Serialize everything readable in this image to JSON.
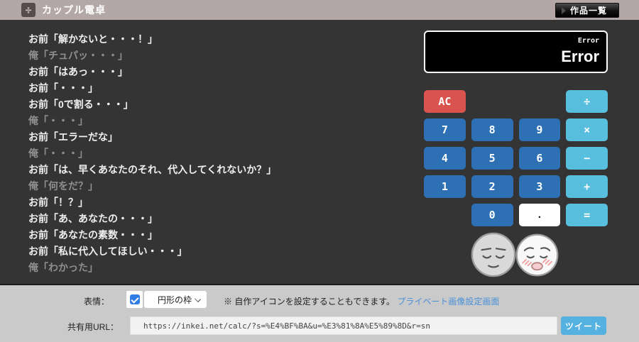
{
  "header": {
    "title": "カップル電卓",
    "icon_glyph": "÷",
    "works_button": "作品一覧"
  },
  "dialogue": {
    "lines": [
      {
        "speaker": "お前",
        "text": "お前「解かないと・・・！」"
      },
      {
        "speaker": "俺",
        "text": "俺「チュパッ・・・」"
      },
      {
        "speaker": "お前",
        "text": "お前「はあっ・・・」"
      },
      {
        "speaker": "お前",
        "text": "お前「・・・」"
      },
      {
        "speaker": "お前",
        "text": "お前「0で割る・・・」"
      },
      {
        "speaker": "俺",
        "text": "俺「・・・」"
      },
      {
        "speaker": "お前",
        "text": "お前「エラーだな」"
      },
      {
        "speaker": "俺",
        "text": "俺「・・・」"
      },
      {
        "speaker": "お前",
        "text": "お前「は、早くあなたのそれ、代入してくれないか？」"
      },
      {
        "speaker": "俺",
        "text": "俺「何をだ？」"
      },
      {
        "speaker": "お前",
        "text": "お前「！？」"
      },
      {
        "speaker": "お前",
        "text": "お前「あ、あなたの・・・」"
      },
      {
        "speaker": "お前",
        "text": "お前「あなたの素数・・・」"
      },
      {
        "speaker": "お前",
        "text": "お前「私に代入してほしい・・・」"
      },
      {
        "speaker": "俺",
        "text": "俺「わかった」"
      }
    ]
  },
  "calculator": {
    "display_small": "Error",
    "display_main": "Error",
    "keys": [
      {
        "label": "AC",
        "type": "clear"
      },
      {
        "label": "÷",
        "type": "op"
      },
      {
        "label": "7",
        "type": "num"
      },
      {
        "label": "8",
        "type": "num"
      },
      {
        "label": "9",
        "type": "num"
      },
      {
        "label": "×",
        "type": "op"
      },
      {
        "label": "4",
        "type": "num"
      },
      {
        "label": "5",
        "type": "num"
      },
      {
        "label": "6",
        "type": "num"
      },
      {
        "label": "−",
        "type": "op"
      },
      {
        "label": "1",
        "type": "num"
      },
      {
        "label": "2",
        "type": "num"
      },
      {
        "label": "3",
        "type": "num"
      },
      {
        "label": "+",
        "type": "op"
      },
      {
        "label": "0",
        "type": "num"
      },
      {
        "label": ".",
        "type": "decimal"
      },
      {
        "label": "=",
        "type": "op"
      }
    ],
    "faces": {
      "left_icon": "calm-face",
      "right_icon": "flushed-face"
    }
  },
  "settings": {
    "expression_label": "表情：",
    "checkbox_checked": true,
    "frame_option": "円形の枠",
    "note": "※ 自作アイコンを設定することもできます。",
    "link": "プライベート画像設定画面"
  },
  "share": {
    "label": "共有用URL：",
    "url": "https://inkei.net/calc/?s=%E4%BF%BA&u=%E3%81%8A%E5%89%8D&r=sn",
    "tweet_label": "ツイート"
  },
  "colors": {
    "header_bg": "#b3a7a7",
    "main_bg": "#343434",
    "footer_bg": "#cacaca",
    "num_key": "#2d71b4",
    "op_key": "#58bedd",
    "clear_key": "#d9534f",
    "decimal_key": "#ffffff",
    "tweet_button": "#55b1e0",
    "link": "#4a90d9"
  }
}
